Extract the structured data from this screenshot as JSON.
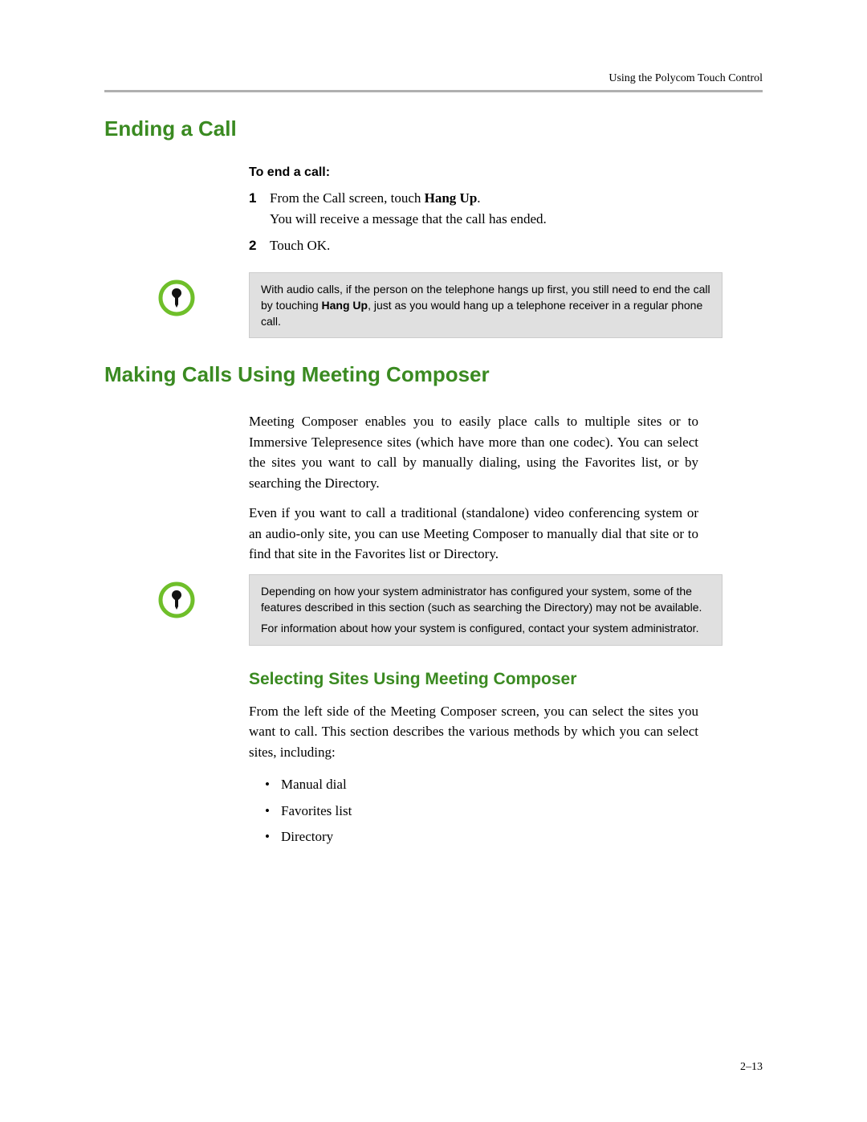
{
  "running_header": "Using the Polycom Touch Control",
  "section1": {
    "title": "Ending a Call",
    "lead": "To end a call:",
    "step1_prefix": "From the Call screen, touch ",
    "step1_bold": "Hang Up",
    "step1_suffix": ".",
    "step1_line2": "You will receive a message that the call has ended.",
    "step2": "Touch OK.",
    "note_p1a": "With audio calls, if the person on the telephone hangs up first, you still need to end the call by touching ",
    "note_p1b": "Hang Up",
    "note_p1c": ", just as you would hang up a telephone receiver in a regular phone call."
  },
  "section2": {
    "title": "Making Calls Using Meeting Composer",
    "para1": "Meeting Composer enables you to easily place calls to multiple sites or to Immersive Telepresence sites (which have more than one codec). You can select the sites you want to call by manually dialing, using the Favorites list, or by searching the Directory.",
    "para2": "Even if you want to call a traditional (standalone) video conferencing system or an audio-only site, you can use Meeting Composer to manually dial that site or to find that site in the Favorites list or Directory.",
    "note_p1": "Depending on how your system administrator has configured your system, some of the features described in this section (such as searching the Directory) may not be available.",
    "note_p2": "For information about how your system is configured, contact your system administrator."
  },
  "section3": {
    "title": "Selecting Sites Using Meeting Composer",
    "para1": "From the left side of the Meeting Composer screen, you can select the sites you want to call. This section describes the various methods by which you can select sites, including:",
    "b1": "Manual dial",
    "b2": "Favorites list",
    "b3": "Directory"
  },
  "page_number": "2–13"
}
